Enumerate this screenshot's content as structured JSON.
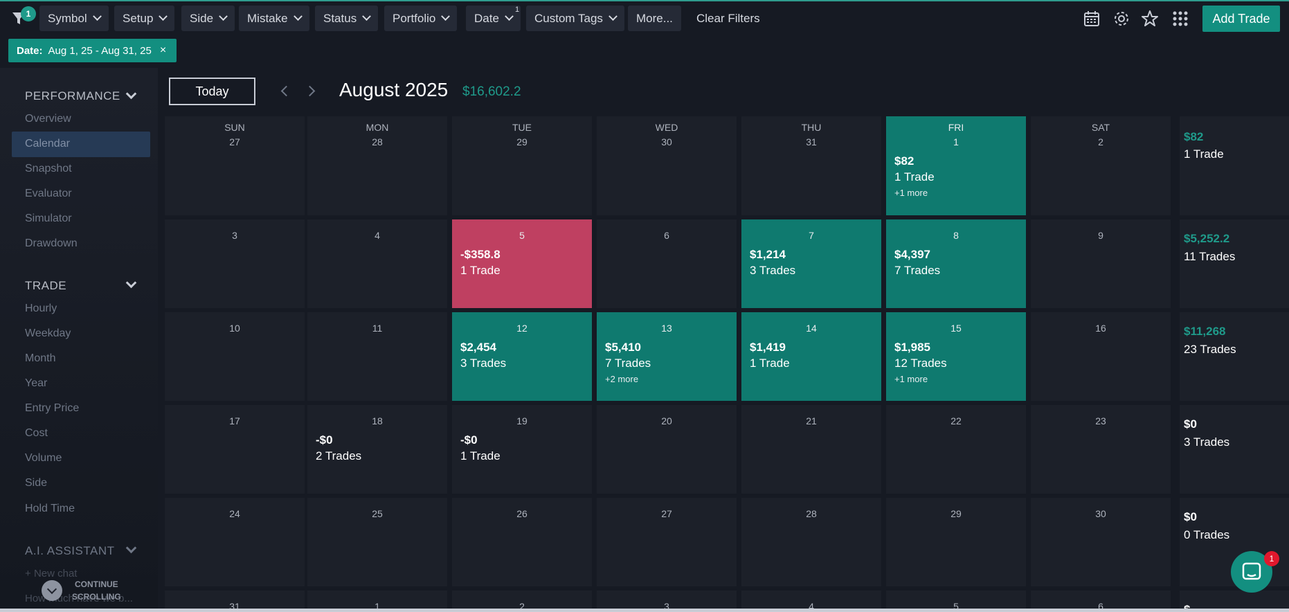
{
  "toolbar": {
    "filter_badge": "1",
    "buttons": [
      "Symbol",
      "Setup",
      "Side",
      "Mistake",
      "Status",
      "Portfolio",
      "Date",
      "Custom Tags",
      "More..."
    ],
    "date_count": "1",
    "clear_filters": "Clear Filters",
    "add_trade": "Add Trade",
    "icons": [
      "calendar-icon",
      "gear-icon",
      "star-icon",
      "apps-grid-icon"
    ]
  },
  "filter_chip": {
    "label": "Date:",
    "value": "Aug 1, 25 - Aug 31, 25",
    "remove": "×"
  },
  "sidebar": {
    "performance_title": "PERFORMANCE",
    "performance_items": [
      "Overview",
      "Calendar",
      "Snapshot",
      "Evaluator",
      "Simulator",
      "Drawdown"
    ],
    "active_item": "Calendar",
    "trade_title": "TRADE",
    "trade_items": [
      "Hourly",
      "Weekday",
      "Month",
      "Year",
      "Entry Price",
      "Cost",
      "Volume",
      "Side",
      "Hold Time"
    ],
    "ai_title": "A.I. ASSISTANT",
    "ai_new_chat": "New chat",
    "ai_recent": "How much have we b...",
    "continue_label_1": "CONTINUE",
    "continue_label_2": "SCROLLING"
  },
  "calendar": {
    "today_button": "Today",
    "month_title": "August 2025",
    "month_total": "$16,602.2",
    "weekdays": [
      "SUN",
      "MON",
      "TUE",
      "WED",
      "THU",
      "FRI",
      "SAT"
    ],
    "weeks": [
      {
        "days": [
          {
            "d": "27"
          },
          {
            "d": "28"
          },
          {
            "d": "29"
          },
          {
            "d": "30"
          },
          {
            "d": "31"
          },
          {
            "d": "1",
            "pnl": "$82",
            "trades": "1 Trade",
            "more": "+1 more",
            "tone": "green"
          },
          {
            "d": "2"
          }
        ],
        "summary": {
          "pnl": "$82",
          "trades": "1 Trade",
          "tone": "green"
        }
      },
      {
        "days": [
          {
            "d": "3"
          },
          {
            "d": "4"
          },
          {
            "d": "5",
            "pnl": "-$358.8",
            "trades": "1 Trade",
            "tone": "red"
          },
          {
            "d": "6"
          },
          {
            "d": "7",
            "pnl": "$1,214",
            "trades": "3 Trades",
            "tone": "green"
          },
          {
            "d": "8",
            "pnl": "$4,397",
            "trades": "7 Trades",
            "tone": "green"
          },
          {
            "d": "9"
          }
        ],
        "summary": {
          "pnl": "$5,252.2",
          "trades": "11 Trades",
          "tone": "green"
        }
      },
      {
        "days": [
          {
            "d": "10"
          },
          {
            "d": "11"
          },
          {
            "d": "12",
            "pnl": "$2,454",
            "trades": "3 Trades",
            "tone": "green"
          },
          {
            "d": "13",
            "pnl": "$5,410",
            "trades": "7 Trades",
            "more": "+2 more",
            "tone": "green"
          },
          {
            "d": "14",
            "pnl": "$1,419",
            "trades": "1 Trade",
            "tone": "green"
          },
          {
            "d": "15",
            "pnl": "$1,985",
            "trades": "12 Trades",
            "more": "+1 more",
            "tone": "green"
          },
          {
            "d": "16"
          }
        ],
        "summary": {
          "pnl": "$11,268",
          "trades": "23 Trades",
          "tone": "green"
        }
      },
      {
        "days": [
          {
            "d": "17"
          },
          {
            "d": "18",
            "pnl": "-$0",
            "trades": "2 Trades",
            "tone": "neutral"
          },
          {
            "d": "19",
            "pnl": "-$0",
            "trades": "1 Trade",
            "tone": "neutral"
          },
          {
            "d": "20"
          },
          {
            "d": "21"
          },
          {
            "d": "22"
          },
          {
            "d": "23"
          }
        ],
        "summary": {
          "pnl": "$0",
          "trades": "3 Trades",
          "tone": "neutral"
        }
      },
      {
        "days": [
          {
            "d": "24"
          },
          {
            "d": "25"
          },
          {
            "d": "26"
          },
          {
            "d": "27"
          },
          {
            "d": "28"
          },
          {
            "d": "29"
          },
          {
            "d": "30"
          }
        ],
        "summary": {
          "pnl": "$0",
          "trades": "0 Trades",
          "tone": "neutral"
        }
      },
      {
        "days": [
          {
            "d": "31"
          },
          {
            "d": "1"
          },
          {
            "d": "2"
          },
          {
            "d": "3"
          },
          {
            "d": "4"
          },
          {
            "d": "5"
          },
          {
            "d": "6"
          }
        ],
        "summary": {
          "pnl": "$",
          "trades": "",
          "tone": "neutral"
        }
      }
    ]
  },
  "chat": {
    "badge": "1"
  },
  "colors": {
    "accent": "#138f80",
    "green_cell": "#0f7a6f",
    "red_cell": "#bf4061",
    "summary_green": "#1f9a8a"
  }
}
